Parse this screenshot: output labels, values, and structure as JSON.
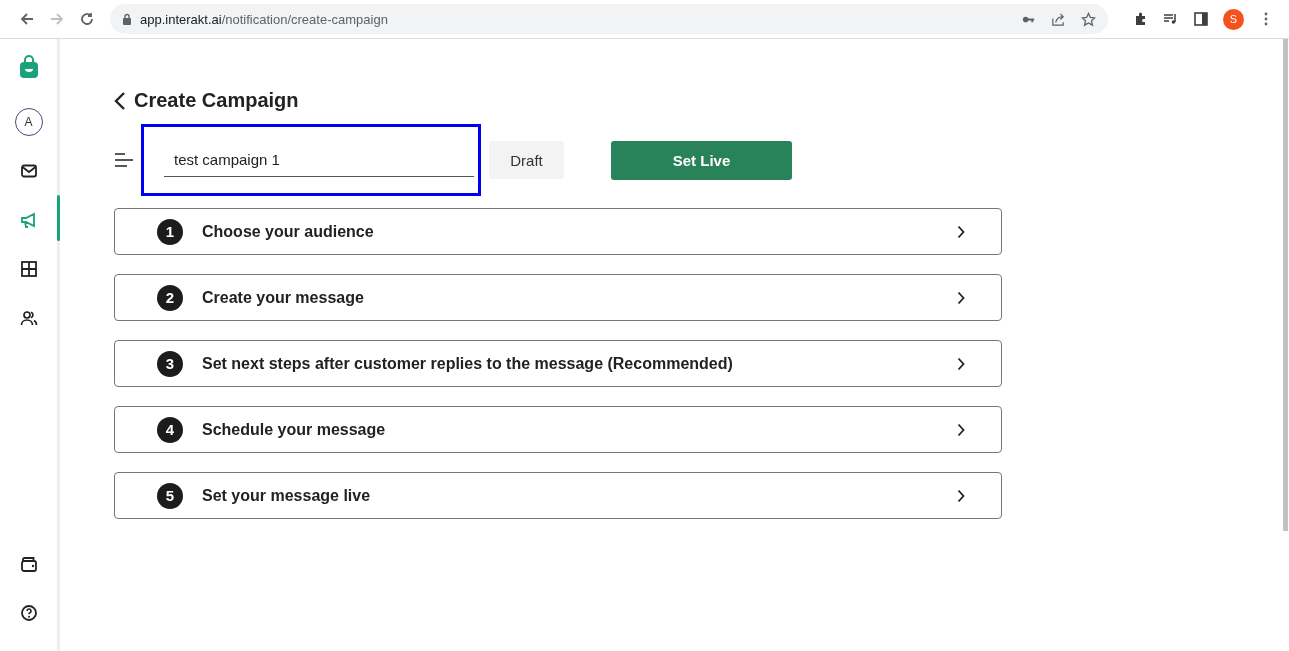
{
  "browser": {
    "url_host": "app.interakt.ai",
    "url_path": "/notification/create-campaign",
    "profile_initial": "S"
  },
  "sidebar": {
    "items": [
      {
        "kind": "avatar",
        "label": "A",
        "selected": false
      },
      {
        "kind": "mail",
        "selected": false
      },
      {
        "kind": "campaign",
        "selected": true
      },
      {
        "kind": "grid",
        "selected": false
      },
      {
        "kind": "contacts",
        "selected": false
      }
    ],
    "bottom_items": [
      {
        "kind": "wallet"
      },
      {
        "kind": "help"
      }
    ]
  },
  "page": {
    "title": "Create Campaign",
    "campaign_name": "test campaign 1",
    "highlighted": true,
    "buttons": [
      {
        "kind": "secondary",
        "label": "Draft"
      },
      {
        "kind": "primary",
        "label": "Set Live"
      }
    ]
  },
  "steps": [
    {
      "number": "1",
      "label": "Choose your audience"
    },
    {
      "number": "2",
      "label": "Create your message"
    },
    {
      "number": "3",
      "label": "Set next steps after customer replies to the message (Recommended)"
    },
    {
      "number": "4",
      "label": "Schedule your message"
    },
    {
      "number": "5",
      "label": "Set your message live"
    }
  ]
}
